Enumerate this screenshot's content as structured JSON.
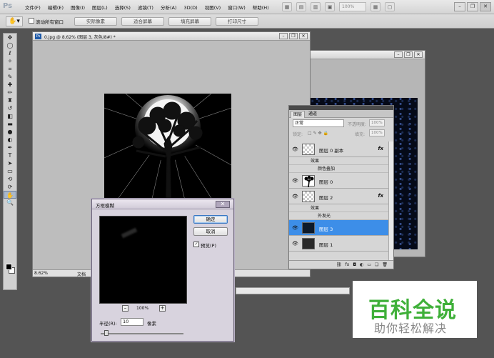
{
  "app": {
    "logo": "Ps"
  },
  "menubar": {
    "items": [
      "文件(F)",
      "编辑(E)",
      "图像(I)",
      "图层(L)",
      "选择(S)",
      "滤镜(T)",
      "分析(A)",
      "3D(D)",
      "视图(V)",
      "窗口(W)",
      "帮助(H)"
    ],
    "zoom": "100%"
  },
  "options": {
    "scroll_all_label": "滚动所有窗口",
    "actual_pixels": "实际像素",
    "fit_screen": "适合屏幕",
    "fill_screen": "填充屏幕",
    "print_size": "打印尺寸"
  },
  "document": {
    "title": "0.jpg @ 8.62% (图层 3, 灰色/8#) *",
    "zoom": "8.62%",
    "doc_label": "文档"
  },
  "layers_panel": {
    "tabs": [
      "图层",
      "通道"
    ],
    "blend_mode": "正常",
    "opacity_label": "不透明度:",
    "opacity": "100%",
    "lock_label": "锁定:",
    "fill_label": "填充:",
    "fill": "100%",
    "effects_label": "效果",
    "layers": [
      {
        "name": "图层 0 副本",
        "fx": "fx",
        "effect": "颜色叠加"
      },
      {
        "name": "图层 0",
        "fx": "",
        "effect": ""
      },
      {
        "name": "图层 2",
        "fx": "fx",
        "effect": "外发光"
      },
      {
        "name": "图层 3",
        "fx": "",
        "effect": ""
      },
      {
        "name": "图层 1",
        "fx": "",
        "effect": ""
      }
    ]
  },
  "dialog": {
    "title": "方框模糊",
    "ok": "确定",
    "cancel": "取消",
    "preview_label": "预览(P)",
    "zoom": "100%",
    "radius_label": "半径(R):",
    "radius_value": "10",
    "radius_unit": "像素"
  },
  "watermark": {
    "title": "百科全说",
    "subtitle": "助你轻松解决"
  }
}
